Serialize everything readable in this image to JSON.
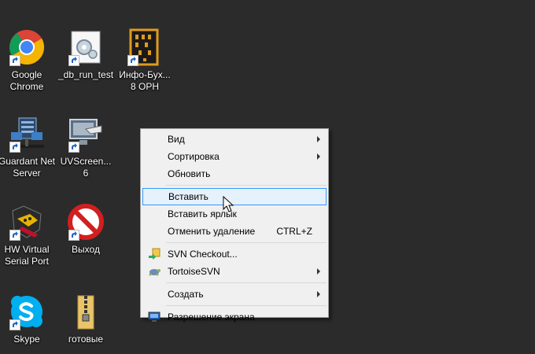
{
  "desktop": {
    "icons": [
      {
        "label": "Google\nChrome",
        "icon": "chrome-icon"
      },
      {
        "label": "_db_run_test",
        "icon": "gear-document-icon"
      },
      {
        "label": "Инфо-Бух...\n8 ОРН",
        "icon": "abacus-icon"
      },
      {
        "label": "Guardant Net\nServer",
        "icon": "network-server-icon"
      },
      {
        "label": "UVScreen...\n6",
        "icon": "monitor-hand-icon"
      },
      {
        "label": "HW Virtual\nSerial Port",
        "icon": "serial-port-icon"
      },
      {
        "label": "Выход",
        "icon": "no-entry-icon"
      },
      {
        "label": "Skype",
        "icon": "skype-icon"
      },
      {
        "label": "готовые",
        "icon": "folder-zip-icon"
      }
    ]
  },
  "menu": {
    "items": [
      {
        "label": "Вид",
        "submenu": true
      },
      {
        "label": "Сортировка",
        "submenu": true
      },
      {
        "label": "Обновить"
      },
      {
        "label": "Вставить",
        "highlight": true
      },
      {
        "label": "Вставить ярлык"
      },
      {
        "label": "Отменить удаление",
        "shortcut": "CTRL+Z"
      },
      {
        "label": "SVN Checkout...",
        "icon": "svn-checkout-icon"
      },
      {
        "label": "TortoiseSVN",
        "icon": "tortoise-svn-icon",
        "submenu": true
      },
      {
        "label": "Создать",
        "submenu": true
      },
      {
        "label": "Разрешение экрана",
        "icon": "display-icon"
      }
    ]
  },
  "colors": {
    "desktop_bg": "#2b2b2b",
    "menu_bg": "#f0f0f0",
    "highlight_bg": "#e5f1fb",
    "highlight_border": "#3399ff"
  }
}
